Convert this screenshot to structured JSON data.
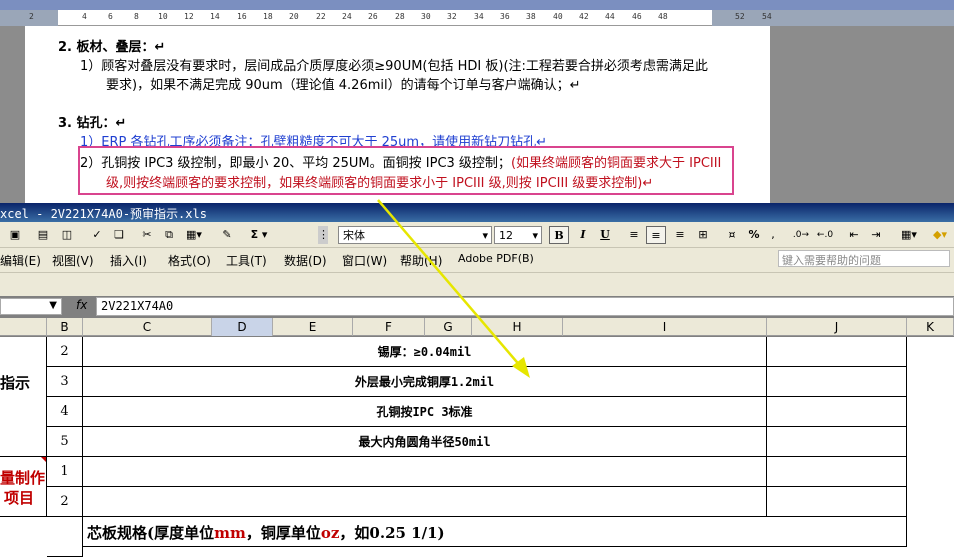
{
  "word": {
    "ruler_numbers": [
      "2",
      "4",
      "6",
      "8",
      "10",
      "12",
      "14",
      "16",
      "18",
      "20",
      "22",
      "24",
      "26",
      "28",
      "30",
      "32",
      "34",
      "36",
      "38",
      "40",
      "42",
      "44",
      "46",
      "48",
      "52",
      "54"
    ],
    "sec2_title": "2.  板材、叠层：↵",
    "sec2_l1": "1）顾客对叠层没有要求时，层间成品介质厚度必须≥90UM(包括 HDI 板)(注:工程若要合拼必须考虑需满足此",
    "sec2_l2": "要求)，如果不满足完成 90um（理论值 4.26mil）的请每个订单与客户端确认；↵",
    "sec3_title": "3.  钻孔：↵",
    "sec3_l1": "1）ERP 各钻孔工序必须备注：孔壁粗糙度不可大于 25um，请使用新钻刀钻孔↵",
    "sec3_l2a": "2）孔铜按 IPC3 级控制，即最小 20、平均 25UM。面铜按 IPC3 级控制；",
    "sec3_l2b": "(如果终端顾客的铜面要求大于 IPCIII",
    "sec3_l3": "级,则按终端顾客的要求控制，如果终端顾客的铜面要求小于 IPCIII 级,则按 IPCIII 级要求控制)↵"
  },
  "excel": {
    "title": "xcel - 2V221X74A0-预审指示.xls",
    "font_name": "宋体",
    "font_size": "12",
    "bold": "B",
    "italic": "I",
    "underline": "U",
    "sum": "Σ",
    "percent": "%",
    "menu": [
      "编辑(E)",
      "视图(V)",
      "插入(I)",
      "格式(O)",
      "工具(T)",
      "数据(D)",
      "窗口(W)",
      "帮助(H)",
      "Adobe PDF(B)"
    ],
    "help_placeholder": "键入需要帮助的问题",
    "fx": "fx",
    "formula": "2V221X74A0",
    "columns": [
      "B",
      "C",
      "D",
      "E",
      "F",
      "G",
      "H",
      "I",
      "J",
      "K"
    ],
    "rows": [
      {
        "num": "2",
        "text": "锡厚：≥0.04mil"
      },
      {
        "num": "3",
        "text": "外层最小完成铜厚1.2mil"
      },
      {
        "num": "4",
        "text": "孔铜按IPC 3标准"
      },
      {
        "num": "5",
        "text": "最大内角圆角半径50mil"
      },
      {
        "num": "1",
        "text": ""
      },
      {
        "num": "2",
        "text": ""
      }
    ],
    "side_label_1": "指示",
    "side_label_2a": "量制作",
    "side_label_2b": "项目",
    "core_pre": "芯板规格(厚度单位",
    "core_mm": "mm",
    "core_mid": "，铜厚单位",
    "core_oz": "oz",
    "core_post": "，如0.25 1/1)"
  }
}
